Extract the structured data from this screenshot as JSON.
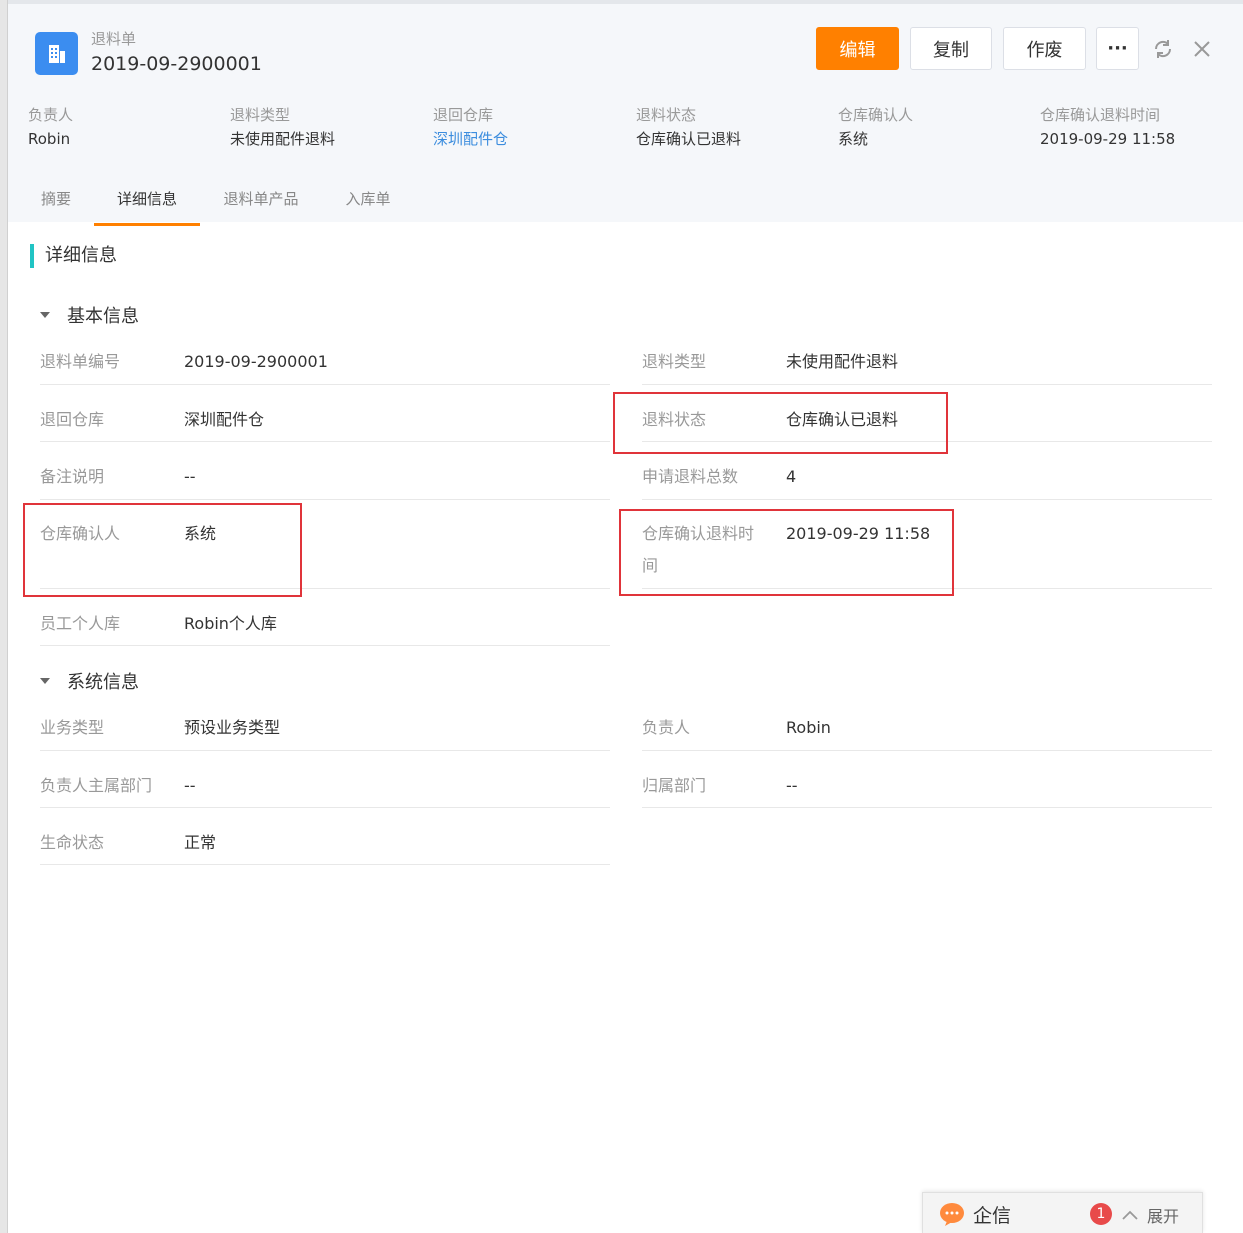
{
  "header": {
    "object_type": "退料单",
    "record_no": "2019-09-2900001",
    "buttons": {
      "edit": "编辑",
      "copy": "复制",
      "void": "作废",
      "more": "···"
    }
  },
  "summary": [
    {
      "label": "负责人",
      "value": "Robin",
      "link": false
    },
    {
      "label": "退料类型",
      "value": "未使用配件退料",
      "link": false
    },
    {
      "label": "退回仓库",
      "value": "深圳配件仓",
      "link": true
    },
    {
      "label": "退料状态",
      "value": "仓库确认已退料",
      "link": false
    },
    {
      "label": "仓库确认人",
      "value": "系统",
      "link": false
    },
    {
      "label": "仓库确认退料时间",
      "value": "2019-09-29 11:58",
      "link": false
    }
  ],
  "tabs": [
    "摘要",
    "详细信息",
    "退料单产品",
    "入库单"
  ],
  "active_tab": "详细信息",
  "section_title": "详细信息",
  "basic": {
    "title": "基本信息",
    "fields": {
      "no": {
        "label": "退料单编号",
        "value": "2019-09-2900001"
      },
      "type": {
        "label": "退料类型",
        "value": "未使用配件退料"
      },
      "warehouse": {
        "label": "退回仓库",
        "value": "深圳配件仓"
      },
      "status": {
        "label": "退料状态",
        "value": "仓库确认已退料"
      },
      "remark": {
        "label": "备注说明",
        "value": "--"
      },
      "total": {
        "label": "申请退料总数",
        "value": "4"
      },
      "confirmer": {
        "label": "仓库确认人",
        "value": "系统"
      },
      "confirm_time": {
        "label_line1": "仓库确认退料时",
        "label_line2": "间",
        "value": "2019-09-29 11:58"
      },
      "personal_store": {
        "label": "员工个人库",
        "value": "Robin个人库"
      }
    }
  },
  "system": {
    "title": "系统信息",
    "fields": {
      "biz_type": {
        "label": "业务类型",
        "value": "预设业务类型"
      },
      "owner": {
        "label": "负责人",
        "value": "Robin"
      },
      "owner_dept": {
        "label": "负责人主属部门",
        "value": "--"
      },
      "dept": {
        "label": "归属部门",
        "value": "--"
      },
      "life_status": {
        "label": "生命状态",
        "value": "正常"
      }
    }
  },
  "qixin": {
    "name": "企信",
    "badge": "1",
    "expand": "展开"
  },
  "colors": {
    "primary": "#ff8000",
    "link": "#3c8dde",
    "accent": "#21c4c4",
    "highlight": "#e0343a"
  }
}
